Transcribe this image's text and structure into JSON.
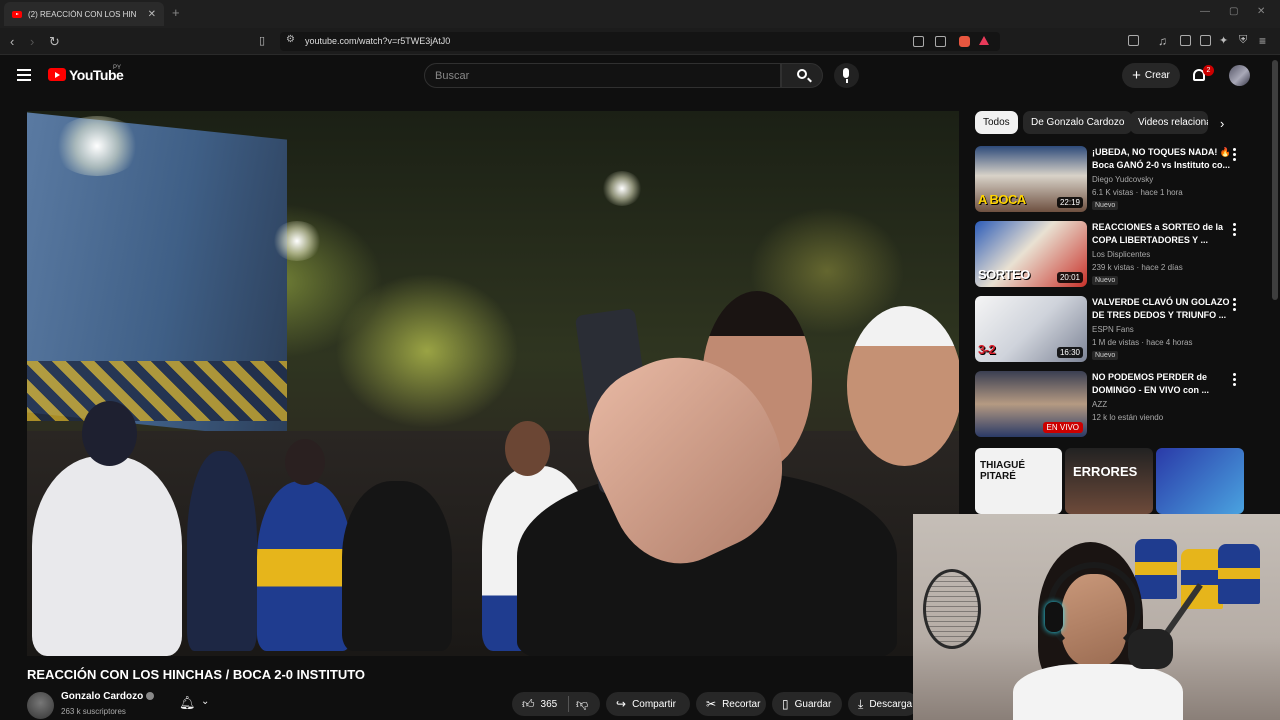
{
  "browser": {
    "tab_title": "(2) REACCIÓN CON LOS HIN",
    "url": "youtube.com/watch?v=r5TWE3jAtJ0"
  },
  "header": {
    "logo_text": "YouTube",
    "logo_country": "PY",
    "search_placeholder": "Buscar",
    "create_label": "Crear",
    "notifications_count": "2"
  },
  "video": {
    "title": "REACCIÓN CON LOS HINCHAS / BOCA 2-0 INSTITUTO",
    "channel": "Gonzalo Cardozo",
    "subscribers": "263 k suscriptores",
    "likes": "365",
    "share_label": "Compartir",
    "clip_label": "Recortar",
    "save_label": "Guardar",
    "download_label": "Descarga"
  },
  "chips": [
    "Todos",
    "De Gonzalo Cardozo",
    "Videos relaciona"
  ],
  "recommendations": [
    {
      "title": "¡UBEDA, NO TOQUES NADA! 🔥 Boca GANÓ 2-0 vs Instituto co...",
      "channel": "Diego Yudcovsky",
      "meta": "6.1 K vistas · hace 1 hora",
      "badge": "Nuevo",
      "duration": "22:19",
      "thumb_text": "A BOCA"
    },
    {
      "title": "REACCIONES a SORTEO de la COPA LIBERTADORES Y ...",
      "channel": "Los Displicentes",
      "meta": "239 k vistas · hace 2 días",
      "badge": "Nuevo",
      "duration": "20:01",
      "thumb_text": "SORTEO"
    },
    {
      "title": "VALVERDE CLAVÓ UN GOLAZO DE TRES DEDOS Y TRIUNFO ...",
      "channel": "ESPN Fans",
      "meta": "1 M de vistas · hace 4 horas",
      "badge": "Nuevo",
      "duration": "16:30",
      "thumb_text": "3-2"
    },
    {
      "title": "NO PODEMOS PERDER de DOMINGO - EN VIVO con ...",
      "channel": "AZZ",
      "meta": "12 k lo están viendo",
      "badge": "",
      "duration": "EN VIVO",
      "thumb_text": ""
    }
  ],
  "shorts": [
    {
      "text": "THIAGUÉ PITARÉ"
    },
    {
      "text": "ERRORES"
    },
    {
      "text": ""
    }
  ]
}
